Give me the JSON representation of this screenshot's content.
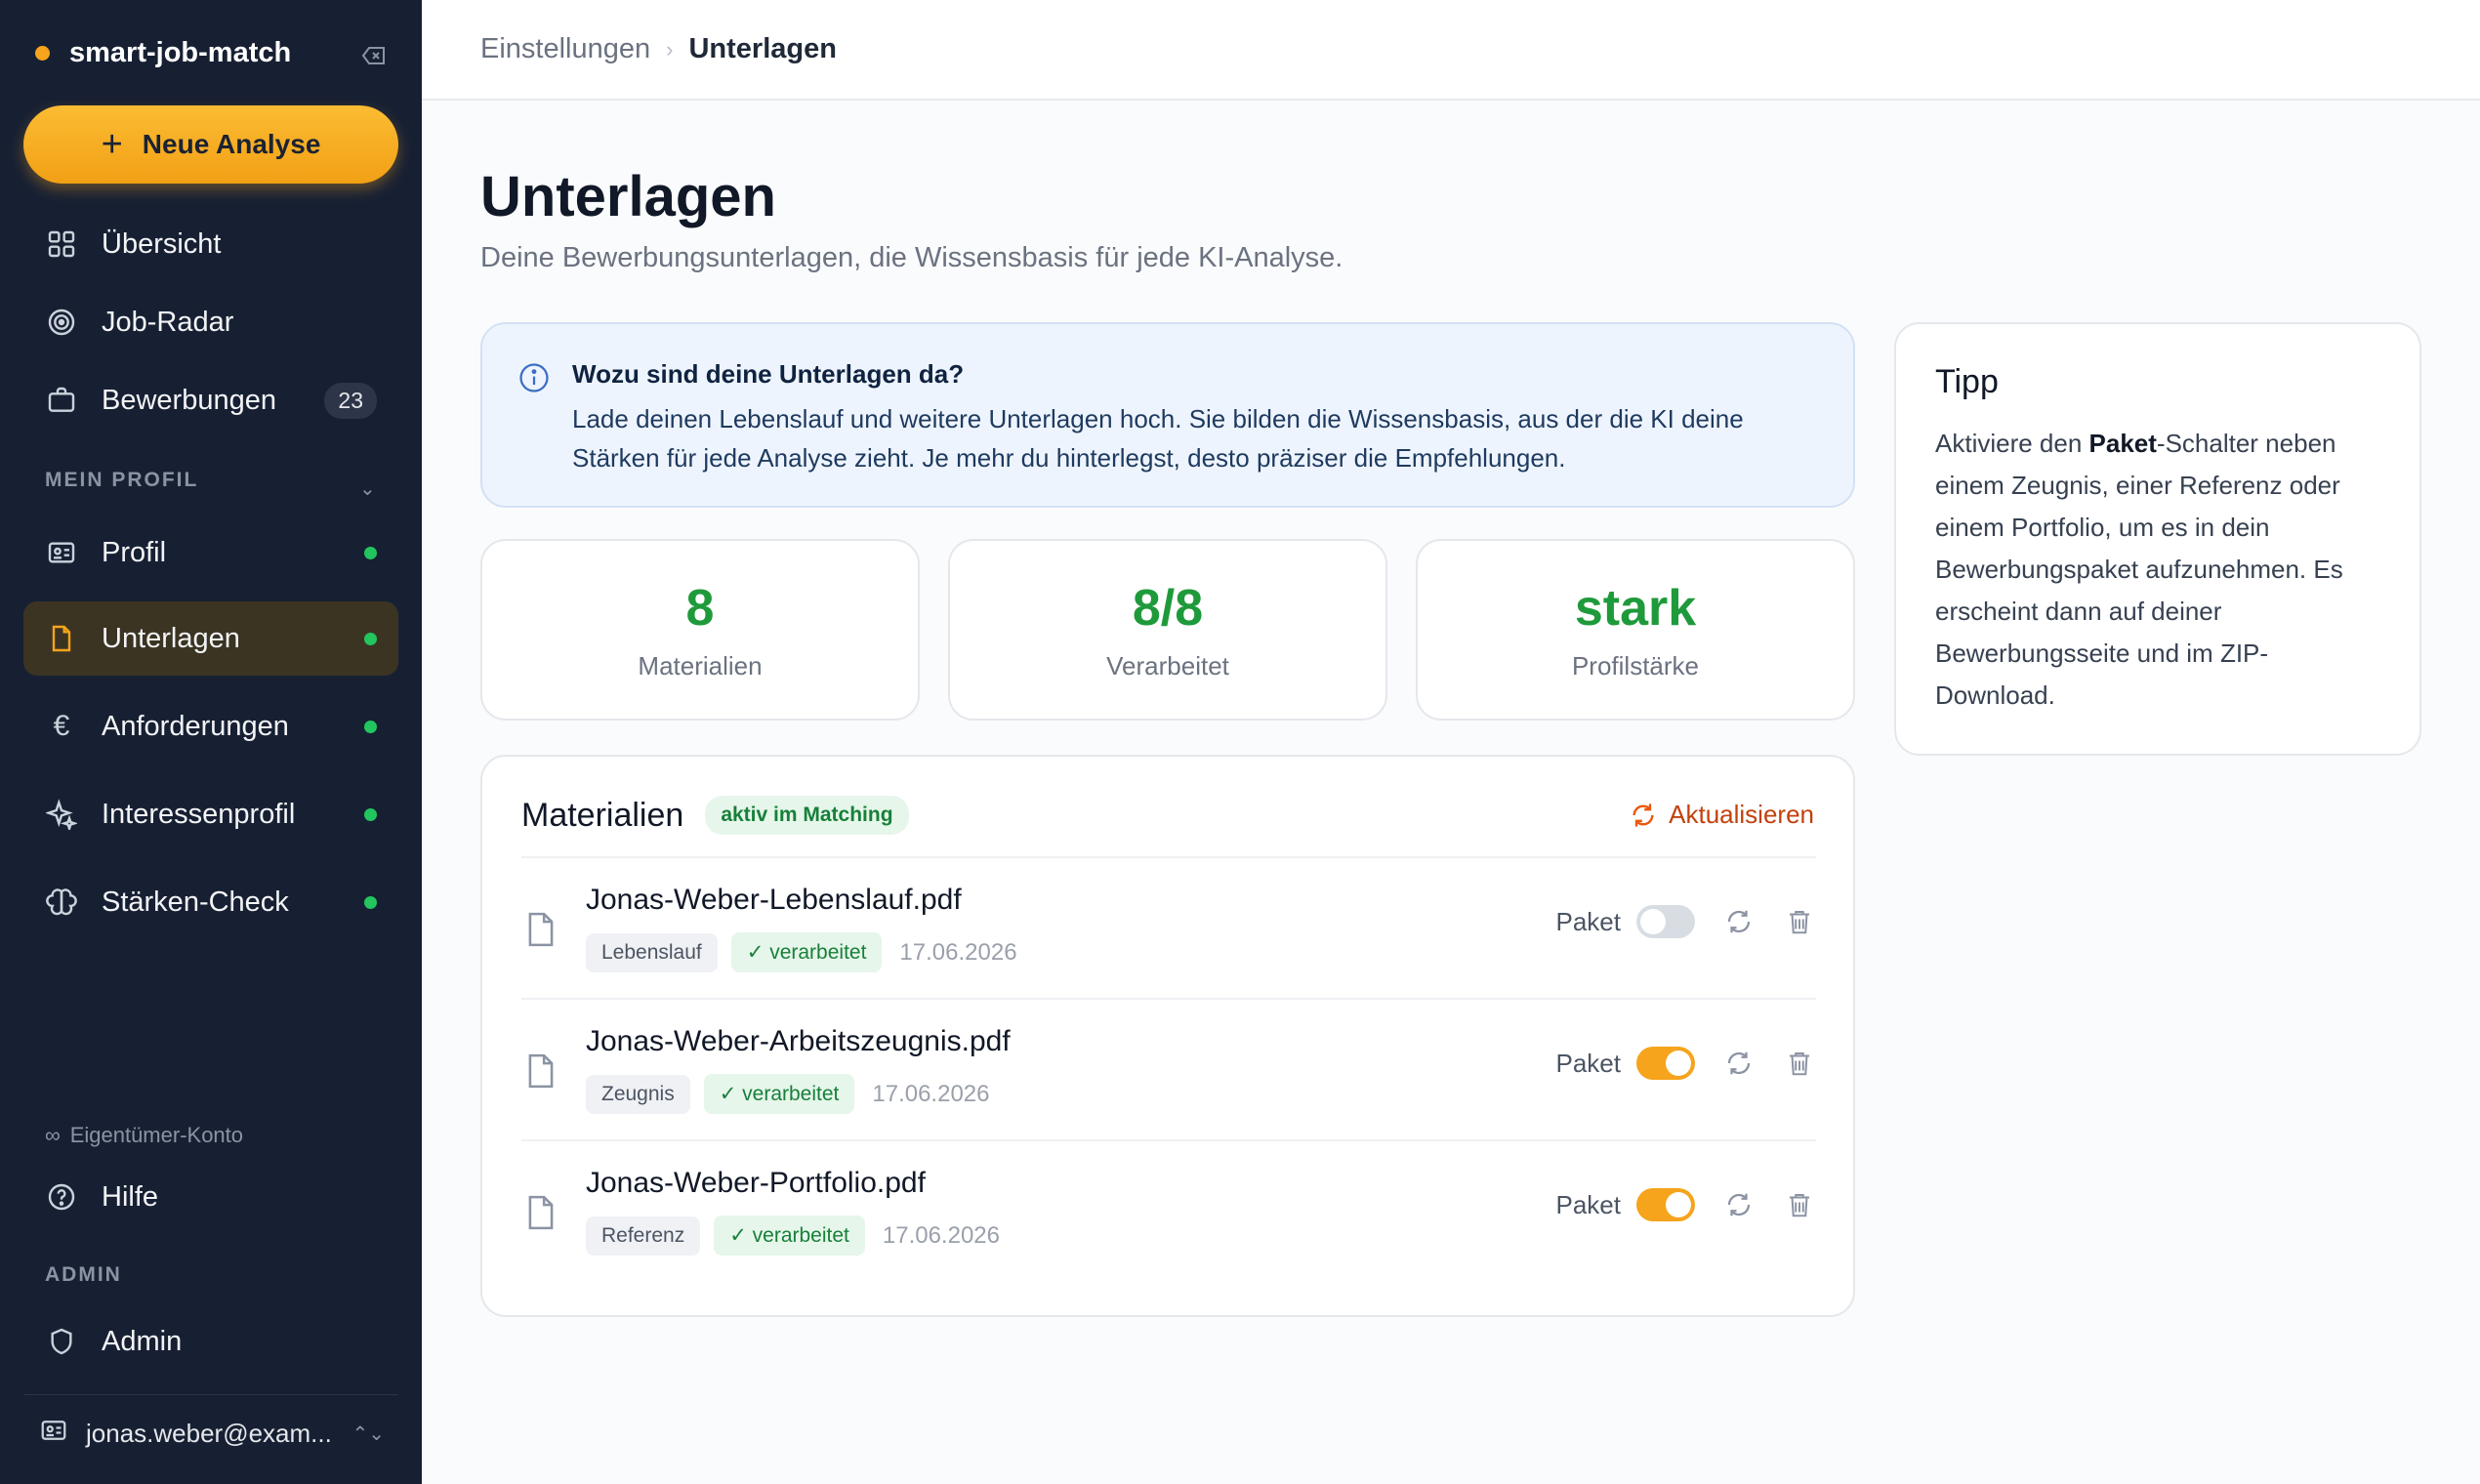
{
  "sidebar": {
    "brand": "smart-job-match",
    "new_analysis": "Neue Analyse",
    "nav": {
      "overview": "Übersicht",
      "job_radar": "Job-Radar",
      "applications": "Bewerbungen",
      "applications_count": "23"
    },
    "section_profile": "MEIN PROFIL",
    "profile_items": {
      "profil": "Profil",
      "unterlagen": "Unterlagen",
      "anforderungen": "Anforderungen",
      "interessenprofil": "Interessenprofil",
      "staerken": "Stärken-Check"
    },
    "owner_account": "Eigentümer-Konto",
    "help": "Hilfe",
    "section_admin": "ADMIN",
    "admin": "Admin",
    "user_email": "jonas.weber@exam..."
  },
  "breadcrumb": {
    "parent": "Einstellungen",
    "current": "Unterlagen"
  },
  "page": {
    "title": "Unterlagen",
    "subtitle": "Deine Bewerbungsunterlagen, die Wissensbasis für jede KI-Analyse."
  },
  "info": {
    "title": "Wozu sind deine Unterlagen da?",
    "text": "Lade deinen Lebenslauf und weitere Unterlagen hoch. Sie bilden die Wissensbasis, aus der die KI deine Stärken für jede Analyse zieht. Je mehr du hinterlegst, desto präziser die Empfehlungen."
  },
  "stats": [
    {
      "value": "8",
      "label": "Materialien"
    },
    {
      "value": "8/8",
      "label": "Verarbeitet"
    },
    {
      "value": "stark",
      "label": "Profilstärke"
    }
  ],
  "materials": {
    "title": "Materialien",
    "badge": "aktiv im Matching",
    "refresh": "Aktualisieren",
    "paket_label": "Paket",
    "files": [
      {
        "name": "Jonas-Weber-Lebenslauf.pdf",
        "type": "Lebenslauf",
        "status": "✓ verarbeitet",
        "date": "17.06.2026",
        "paket": false
      },
      {
        "name": "Jonas-Weber-Arbeitszeugnis.pdf",
        "type": "Zeugnis",
        "status": "✓ verarbeitet",
        "date": "17.06.2026",
        "paket": true
      },
      {
        "name": "Jonas-Weber-Portfolio.pdf",
        "type": "Referenz",
        "status": "✓ verarbeitet",
        "date": "17.06.2026",
        "paket": true
      }
    ]
  },
  "tip": {
    "title": "Tipp",
    "text_before": "Aktiviere den ",
    "text_bold": "Paket",
    "text_after": "-Schalter neben einem Zeugnis, einer Referenz oder einem Portfolio, um es in dein Bewerbungspaket aufzunehmen. Es erscheint dann auf deiner Bewerbungsseite und im ZIP-Download."
  },
  "colors": {
    "sidebar_bg": "#172033",
    "accent": "#f5a41c",
    "success": "#1f9a3b",
    "link": "#c2410c"
  }
}
